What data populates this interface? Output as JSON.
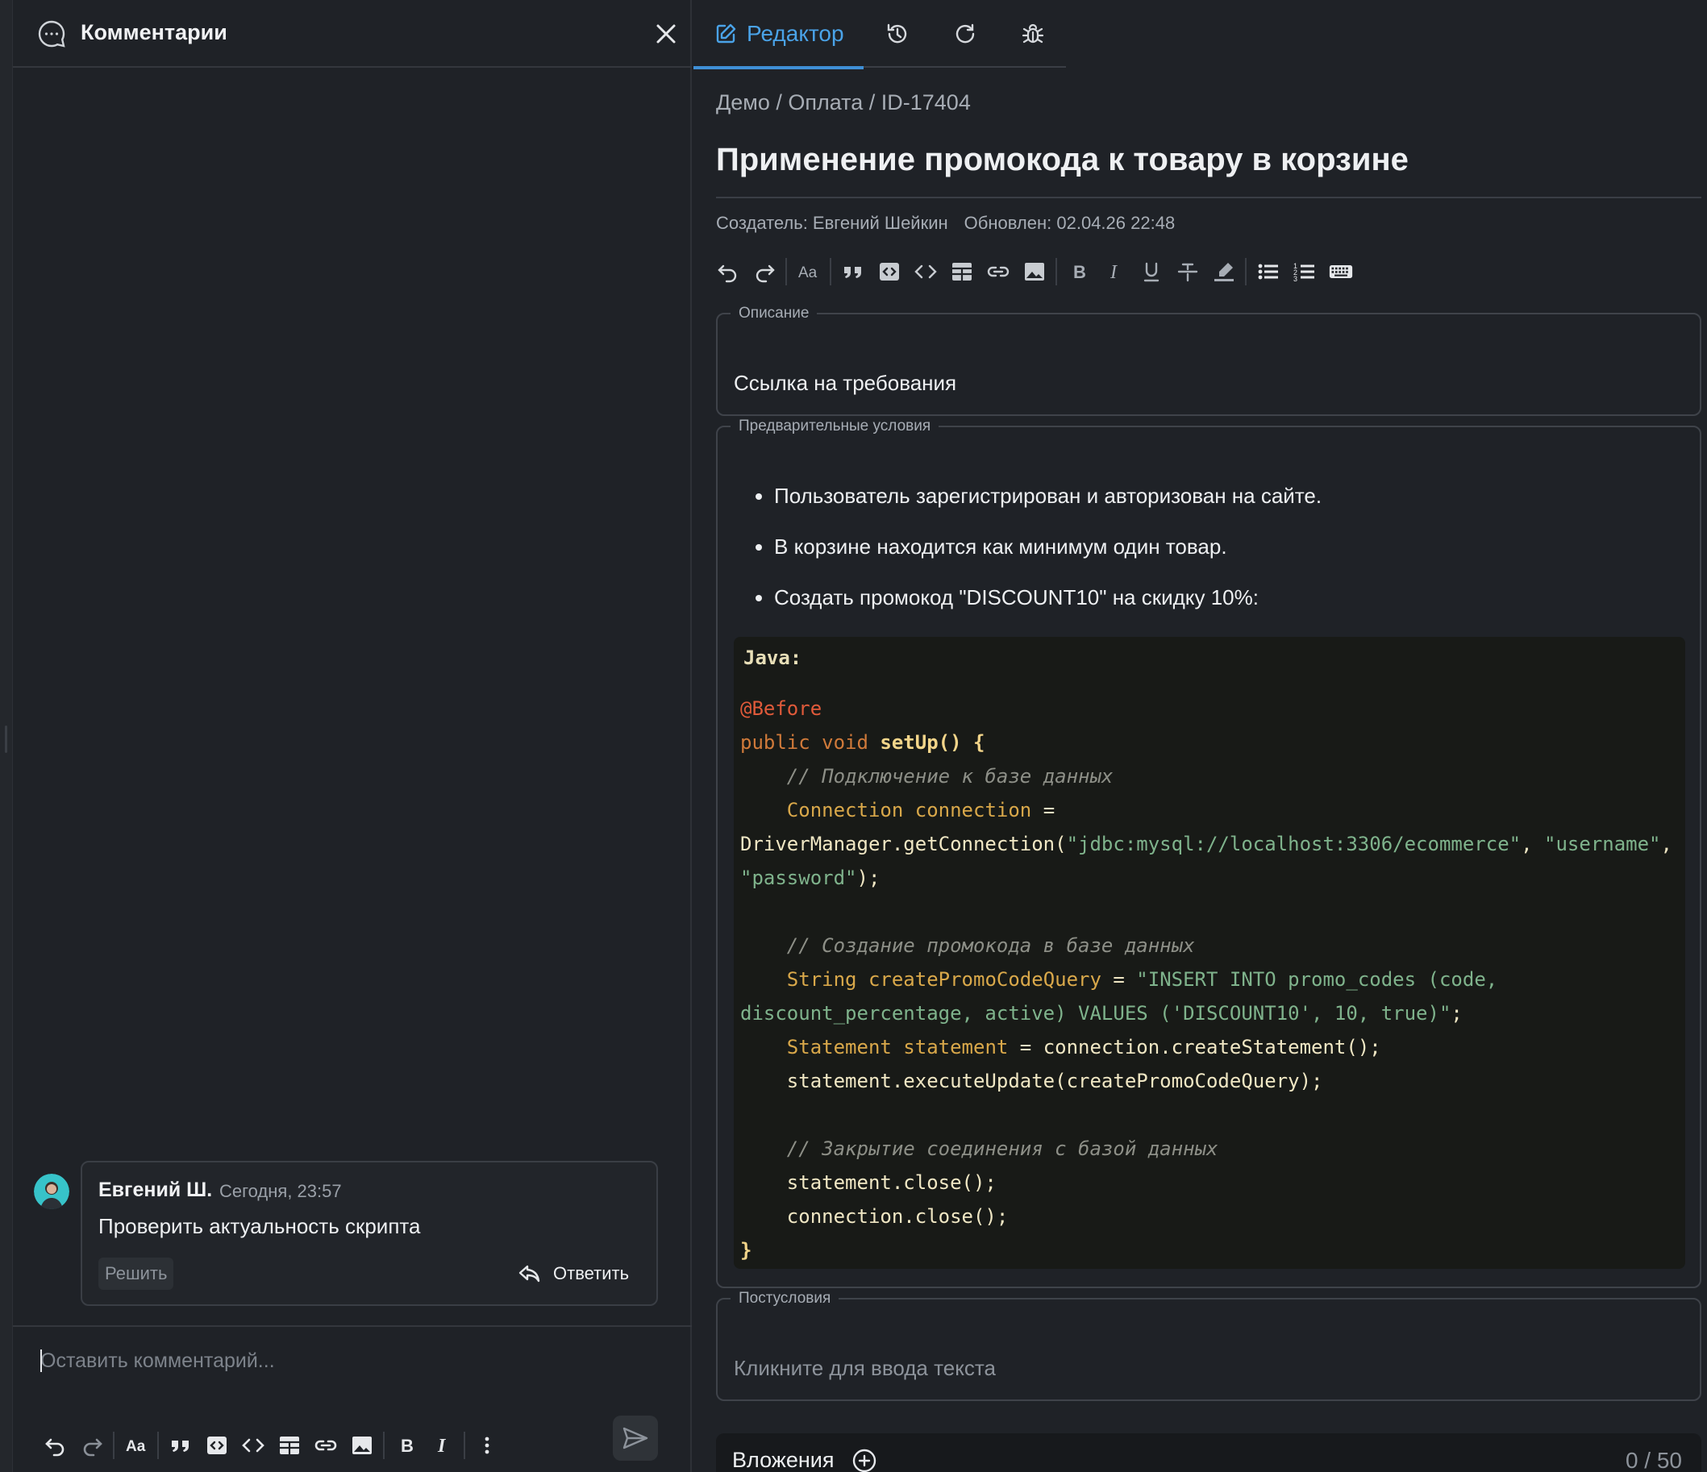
{
  "comments_panel": {
    "title": "Комментарии",
    "comment": {
      "author": "Евгений Ш.",
      "time": "Сегодня, 23:57",
      "text": "Проверить актуальность скрипта",
      "resolve_label": "Решить",
      "reply_label": "Ответить"
    },
    "input_placeholder": "Оставить комментарий..."
  },
  "editor": {
    "tab_label": "Редактор",
    "breadcrumb": "Демо / Оплата / ID-17404",
    "title": "Применение промокода к товару в корзине",
    "creator": "Создатель: Евгений Шейкин",
    "updated": "Обновлен: 02.04.26 22:48",
    "description": {
      "legend": "Описание",
      "value": "Ссылка на требования"
    },
    "preconditions": {
      "legend": "Предварительные условия",
      "items": [
        "Пользователь зарегистрирован и авторизован на сайте.",
        "В корзине находится как минимум один товар.",
        "Создать промокод \"DISCOUNT10\" на скидку 10%:"
      ],
      "code_lang": "Java:",
      "code": {
        "annotation": "@Before",
        "kw_public": "public",
        "kw_void": "void",
        "fn_setup": "setUp",
        "comment1": "// Подключение к базе данных",
        "type_connection": "Connection",
        "var_connection": "connection",
        "driver_call": "DriverManager.getConnection(",
        "str_url": "\"jdbc:mysql://localhost:3306/ecommerce\"",
        "str_user": "\"username\"",
        "str_pass": "\"password\"",
        "comment2": "// Создание промокода в базе данных",
        "type_string": "String",
        "var_query": "createPromoCodeQuery",
        "str_query1": "\"INSERT INTO promo_codes (code,",
        "str_query2": "discount_percentage, active) VALUES ('DISCOUNT10', 10, true)\"",
        "type_statement": "Statement",
        "var_statement": "statement",
        "create_stmt": "connection.createStatement();",
        "exec_update": "statement.executeUpdate(createPromoCodeQuery);",
        "comment3": "// Закрытие соединения с базой данных",
        "close_stmt": "statement.close();",
        "close_conn": "connection.close();"
      }
    },
    "postconditions": {
      "legend": "Постусловия",
      "placeholder": "Кликните для ввода текста"
    },
    "attachments": {
      "label": "Вложения",
      "count": "0 / 50"
    }
  },
  "icons": {
    "chat": "chat-icon",
    "close": "close-icon",
    "edit": "edit-icon",
    "history": "history-icon",
    "refresh": "refresh-icon",
    "bug": "bug-icon"
  },
  "colors": {
    "accent": "#4aa3e8",
    "background": "#1f2227",
    "code_background": "#181a17"
  }
}
